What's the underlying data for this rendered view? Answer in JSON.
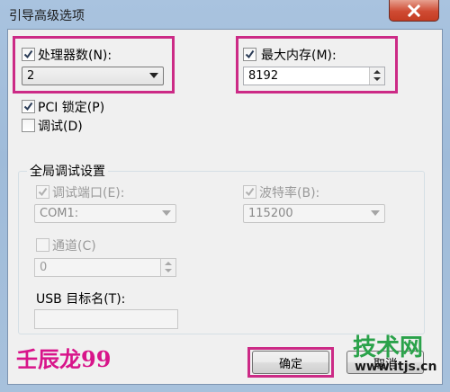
{
  "window": {
    "title": "引导高级选项"
  },
  "processors": {
    "label": "处理器数(N):",
    "value": "2",
    "checked": true
  },
  "memory": {
    "label": "最大内存(M):",
    "value": "8192",
    "checked": true
  },
  "pci_lock": {
    "label": "PCI 锁定(P)",
    "checked": true
  },
  "debug": {
    "label": "调试(D)",
    "checked": false
  },
  "global_debug": {
    "title": "全局调试设置",
    "debug_port": {
      "label": "调试端口(E):",
      "value": "COM1:",
      "checked": true
    },
    "baud_rate": {
      "label": "波特率(B):",
      "value": "115200",
      "checked": true
    },
    "channel": {
      "label": "通道(C)",
      "value": "0",
      "checked": false
    },
    "usb_target": {
      "label": "USB 目标名(T):",
      "value": ""
    }
  },
  "buttons": {
    "ok": "确定",
    "cancel": "取消"
  },
  "watermarks": {
    "left": "壬辰龙99",
    "right_logo": "技术网",
    "right_url": "www.itjs.cn"
  },
  "colors": {
    "highlight": "#cc2a86",
    "close_button": "#c43c22",
    "titlebar": "#a9c3df"
  }
}
